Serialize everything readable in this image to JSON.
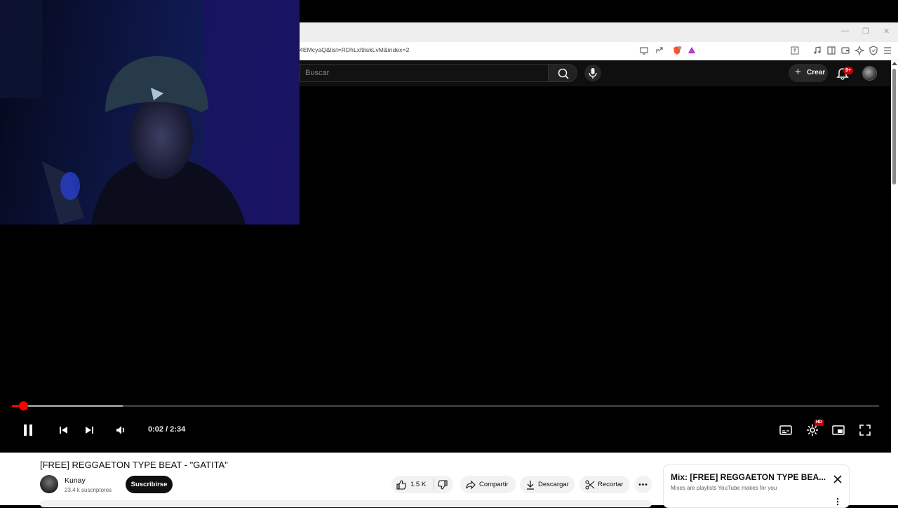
{
  "browser": {
    "url": "4EMcyaQ&list=RDhLxl9iskLvM&index=2"
  },
  "header": {
    "search_placeholder": "Buscar",
    "create_label": "Crear",
    "notifications_badge": "9+"
  },
  "player": {
    "time_display": "0:02 / 2:34",
    "progress_fraction": 0.013,
    "buffered_fraction": 0.128,
    "hd_badge": "HD",
    "state": "playing"
  },
  "video": {
    "title": "[FREE] REGGAETON TYPE BEAT - \"GATITA\"",
    "channel_name": "Kunay",
    "subscribers": "23.4 k suscriptores",
    "subscribe_label": "Suscribirse",
    "likes": "1.5 K",
    "share_label": "Compartir",
    "download_label": "Descargar",
    "clip_label": "Recortar"
  },
  "mix_panel": {
    "title": "Mix: [FREE] REGGAETON TYPE BEA...",
    "subtitle": "Mixes are playlists YouTube makes for you"
  },
  "colors": {
    "accent_red": "#ff0000",
    "player_bg": "#000000",
    "header_bg": "#0f0f0f",
    "subscribe_bg": "#0f0f0f"
  }
}
